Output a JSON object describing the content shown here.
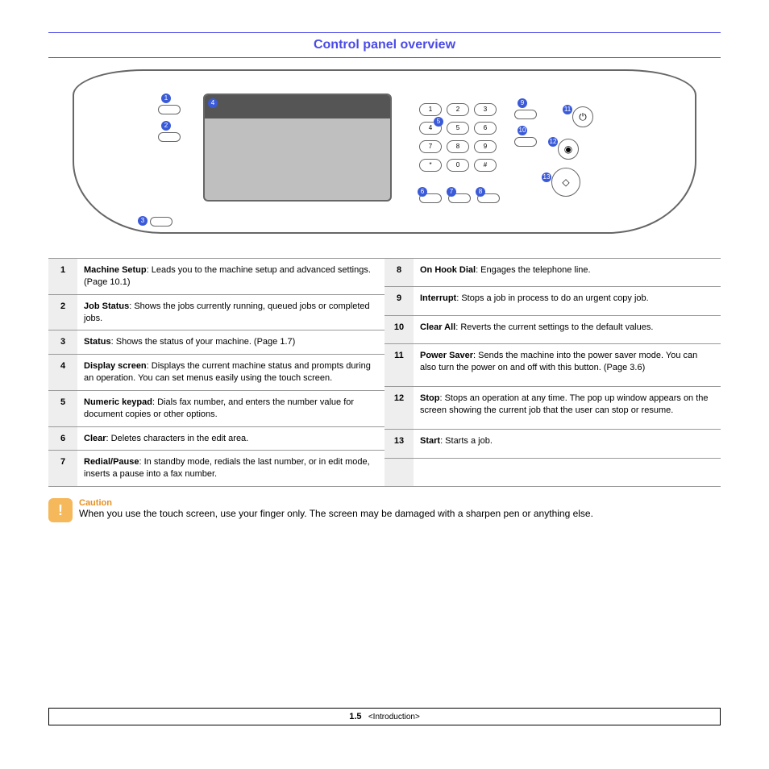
{
  "title": "Control panel overview",
  "keypad": [
    "1",
    "2",
    "3",
    "4",
    "5",
    "6",
    "7",
    "8",
    "9",
    "*",
    "0",
    "#"
  ],
  "callouts": [
    "1",
    "2",
    "3",
    "4",
    "5",
    "6",
    "7",
    "8",
    "9",
    "10",
    "11",
    "12",
    "13"
  ],
  "left": [
    {
      "n": "1",
      "term": "Machine Setup",
      "desc": ": Leads you to the machine setup and advanced settings. (Page 10.1)"
    },
    {
      "n": "2",
      "term": "Job Status",
      "desc": ": Shows the jobs currently running, queued jobs or completed jobs."
    },
    {
      "n": "3",
      "term": "Status",
      "desc": ": Shows the status of your machine. (Page 1.7)"
    },
    {
      "n": "4",
      "term": "Display screen",
      "desc": ": Displays the current machine status and prompts during an operation. You can set menus easily using the touch screen."
    },
    {
      "n": "5",
      "term": "Numeric keypad",
      "desc": ": Dials fax number, and enters the number value for document copies or other options."
    },
    {
      "n": "6",
      "term": "Clear",
      "desc": ": Deletes characters in the edit area."
    },
    {
      "n": "7",
      "term": "Redial/Pause",
      "desc": ": In standby mode, redials the last number, or in edit mode, inserts a pause into a fax number."
    }
  ],
  "right": [
    {
      "n": "8",
      "term": "On Hook Dial",
      "desc": ": Engages the telephone line."
    },
    {
      "n": "9",
      "term": "Interrupt",
      "desc": ": Stops a job in process to do an urgent copy job."
    },
    {
      "n": "10",
      "term": "Clear All",
      "desc": ": Reverts the current settings to the default values."
    },
    {
      "n": "11",
      "term": "Power Saver",
      "desc": ": Sends the machine into the power saver mode. You can also turn the power on and off with this button. (Page 3.6)"
    },
    {
      "n": "12",
      "term": "Stop",
      "desc": ": Stops an operation at any time. The pop up window appears on the screen showing the current job that the user can stop or resume."
    },
    {
      "n": "13",
      "term": "Start",
      "desc": ": Starts a job."
    }
  ],
  "caution": {
    "label": "Caution",
    "text": "When you use the touch screen, use your finger only. The screen may be damaged with a sharpen pen or anything else."
  },
  "footer": {
    "page": "1.5",
    "section": "<Introduction>"
  }
}
